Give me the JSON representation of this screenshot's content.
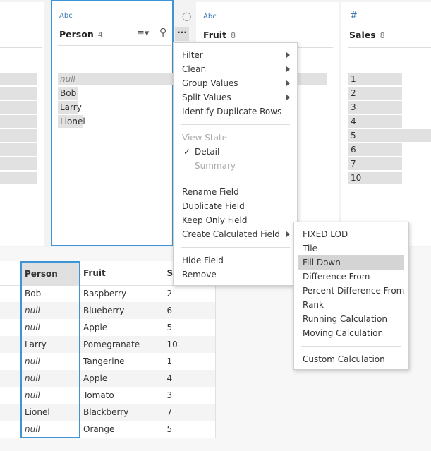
{
  "profile": {
    "left_bar_count": 8,
    "person": {
      "type_label": "Abc",
      "name": "Person",
      "count": "4",
      "values": [
        {
          "label": "null",
          "null": true
        },
        {
          "label": "Bob"
        },
        {
          "label": "Larry"
        },
        {
          "label": "Lionel"
        }
      ]
    },
    "fruit": {
      "type_label": "Abc",
      "name": "Fruit",
      "count": "8"
    },
    "sales": {
      "type_label": "#",
      "name": "Sales",
      "count": "8",
      "values": [
        "1",
        "2",
        "3",
        "4",
        "5",
        "6",
        "7",
        "10"
      ]
    }
  },
  "menu": {
    "items": [
      {
        "label": "Filter",
        "submenu": true
      },
      {
        "label": "Clean",
        "submenu": true
      },
      {
        "label": "Group Values",
        "submenu": true
      },
      {
        "label": "Split Values",
        "submenu": true
      },
      {
        "label": "Identify Duplicate Rows"
      }
    ],
    "view_state": {
      "heading": "View State",
      "detail": "Detail",
      "summary": "Summary",
      "checked": "Detail"
    },
    "field_items": [
      {
        "label": "Rename Field"
      },
      {
        "label": "Duplicate Field"
      },
      {
        "label": "Keep Only Field"
      },
      {
        "label": "Create Calculated Field",
        "submenu": true
      }
    ],
    "bottom_items": [
      {
        "label": "Hide Field"
      },
      {
        "label": "Remove"
      }
    ]
  },
  "submenu": {
    "items": [
      "FIXED LOD",
      "Tile",
      "Fill Down",
      "Difference From",
      "Percent Difference From",
      "Rank",
      "Running Calculation",
      "Moving Calculation"
    ],
    "custom": "Custom Calculation",
    "highlighted": "Fill Down"
  },
  "grid": {
    "headers": [
      "Person",
      "Fruit",
      "S"
    ],
    "rows": [
      [
        "Bob",
        "Raspberry",
        "2"
      ],
      [
        "null",
        "Blueberry",
        "6"
      ],
      [
        "null",
        "Apple",
        "5"
      ],
      [
        "Larry",
        "Pomegranate",
        "10"
      ],
      [
        "null",
        "Tangerine",
        "1"
      ],
      [
        "null",
        "Apple",
        "4"
      ],
      [
        "null",
        "Tomato",
        "3"
      ],
      [
        "Lionel",
        "Blackberry",
        "7"
      ],
      [
        "null",
        "Orange",
        "5"
      ]
    ]
  },
  "colors": {
    "accent": "#3d94d6",
    "bar": "#e1e1e1",
    "highlight": "#d4d4d4"
  }
}
